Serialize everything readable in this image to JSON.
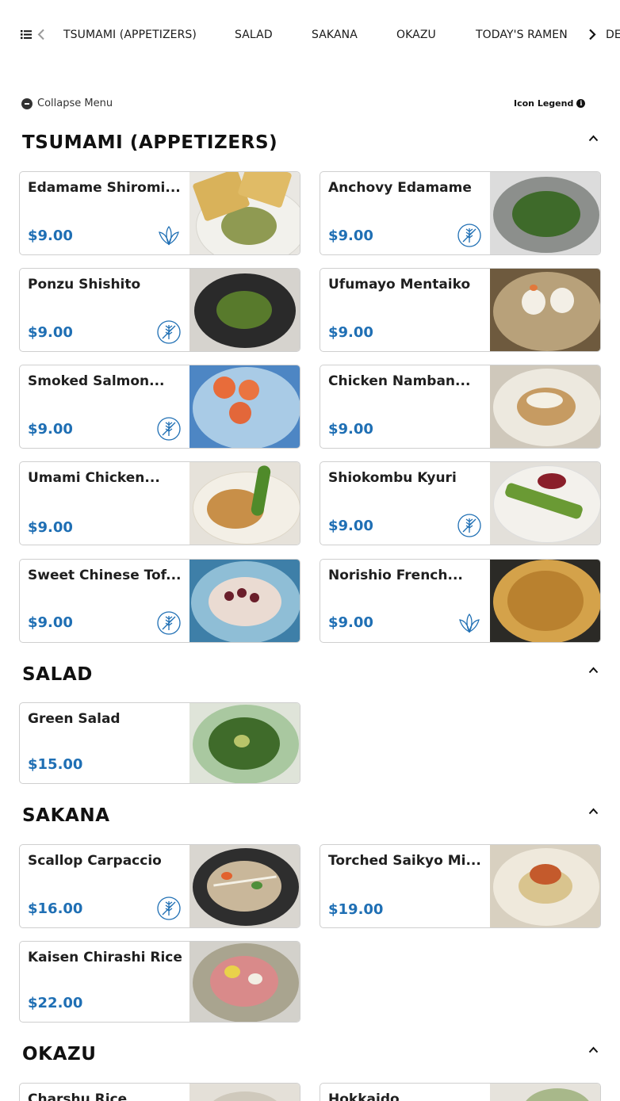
{
  "nav": {
    "categories": [
      "TSUMAMI (APPETIZERS)",
      "SALAD",
      "SAKANA",
      "OKAZU",
      "TODAY'S RAMEN",
      "DE"
    ]
  },
  "controls": {
    "collapse_label": "Collapse Menu",
    "legend_label": "Icon Legend"
  },
  "colors": {
    "price": "#1f6fb4",
    "icon": "#1f6fb4",
    "text": "#1a1a1a"
  },
  "sections": [
    {
      "title": "TSUMAMI (APPETIZERS)",
      "items": [
        {
          "name": "Edamame Shiromi...",
          "price": "$9.00",
          "icon": "vegan-leaf-icon"
        },
        {
          "name": "Anchovy Edamame",
          "price": "$9.00",
          "icon": "gluten-free-icon"
        },
        {
          "name": "Ponzu Shishito",
          "price": "$9.00",
          "icon": "gluten-free-icon"
        },
        {
          "name": "Ufumayo Mentaiko",
          "price": "$9.00",
          "icon": ""
        },
        {
          "name": "Smoked Salmon...",
          "price": "$9.00",
          "icon": "gluten-free-icon"
        },
        {
          "name": "Chicken Namban...",
          "price": "$9.00",
          "icon": ""
        },
        {
          "name": "Umami Chicken...",
          "price": "$9.00",
          "icon": ""
        },
        {
          "name": "Shiokombu Kyuri",
          "price": "$9.00",
          "icon": "gluten-free-icon"
        },
        {
          "name": "Sweet Chinese Tof...",
          "price": "$9.00",
          "icon": "gluten-free-icon"
        },
        {
          "name": "Norishio French...",
          "price": "$9.00",
          "icon": "vegan-leaf-icon"
        }
      ]
    },
    {
      "title": "SALAD",
      "items": [
        {
          "name": "Green Salad",
          "price": "$15.00",
          "icon": ""
        }
      ]
    },
    {
      "title": "SAKANA",
      "items": [
        {
          "name": "Scallop Carpaccio",
          "price": "$16.00",
          "icon": "gluten-free-icon"
        },
        {
          "name": "Torched Saikyo Mi...",
          "price": "$19.00",
          "icon": ""
        },
        {
          "name": "Kaisen Chirashi Rice",
          "price": "$22.00",
          "icon": ""
        }
      ]
    },
    {
      "title": "OKAZU",
      "items": [
        {
          "name": "Charshu Rice",
          "price": "",
          "icon": ""
        },
        {
          "name": "Hokkaido",
          "price": "",
          "icon": ""
        }
      ]
    }
  ]
}
